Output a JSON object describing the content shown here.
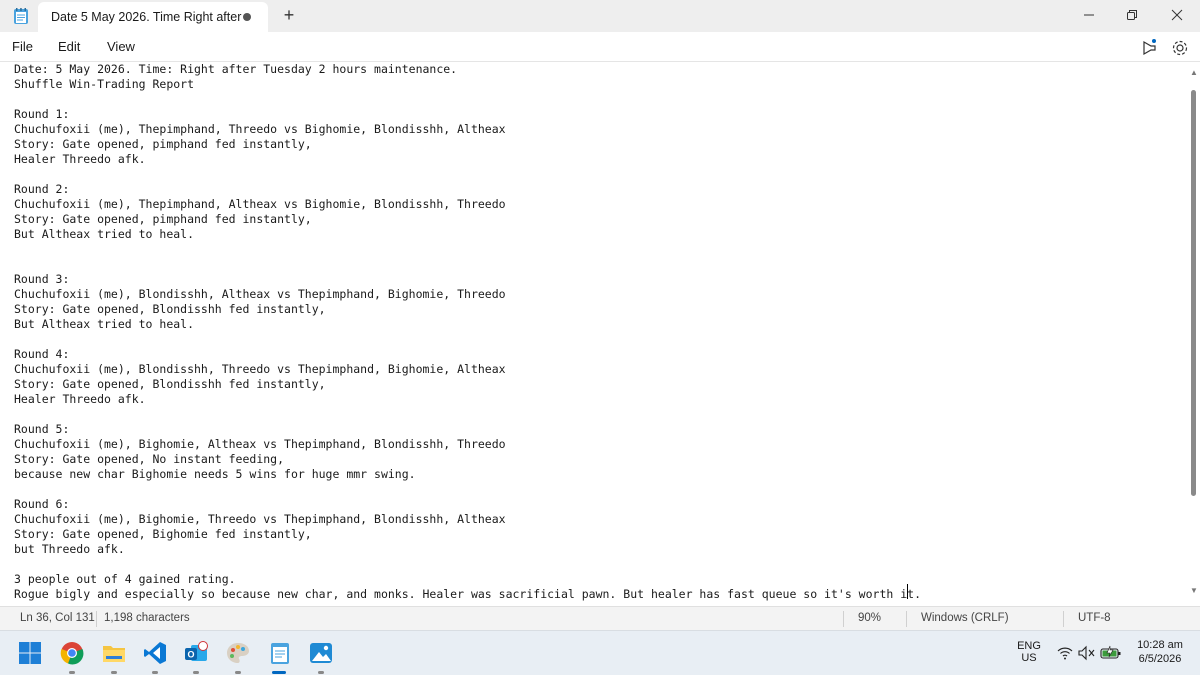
{
  "titlebar": {
    "tab_title": "Date 5 May 2026. Time Right after",
    "new_tab": "+"
  },
  "menu": {
    "file": "File",
    "edit": "Edit",
    "view": "View"
  },
  "document": {
    "lines": [
      "Date: 5 May 2026. Time: Right after Tuesday 2 hours maintenance.",
      "Shuffle Win-Trading Report",
      "",
      "Round 1:",
      "Chuchufoxii (me), Thepimphand, Threedo vs Bighomie, Blondisshh, Altheax",
      "Story: Gate opened, pimphand fed instantly,",
      "Healer Threedo afk.",
      "",
      "Round 2:",
      "Chuchufoxii (me), Thepimphand, Altheax vs Bighomie, Blondisshh, Threedo",
      "Story: Gate opened, pimphand fed instantly,",
      "But Altheax tried to heal.",
      "",
      "",
      "Round 3:",
      "Chuchufoxii (me), Blondisshh, Altheax vs Thepimphand, Bighomie, Threedo",
      "Story: Gate opened, Blondisshh fed instantly,",
      "But Altheax tried to heal.",
      "",
      "Round 4:",
      "Chuchufoxii (me), Blondisshh, Threedo vs Thepimphand, Bighomie, Altheax",
      "Story: Gate opened, Blondisshh fed instantly,",
      "Healer Threedo afk.",
      "",
      "Round 5:",
      "Chuchufoxii (me), Bighomie, Altheax vs Thepimphand, Blondisshh, Threedo",
      "Story: Gate opened, No instant feeding,",
      "because new char Bighomie needs 5 wins for huge mmr swing.",
      "",
      "Round 6:",
      "Chuchufoxii (me), Bighomie, Threedo vs Thepimphand, Blondisshh, Altheax",
      "Story: Gate opened, Bighomie fed instantly,",
      "but Threedo afk.",
      "",
      "3 people out of 4 gained rating.",
      "Rogue bigly and especially so because new char, and monks. Healer was sacrificial pawn. But healer has fast queue so it's worth it."
    ]
  },
  "status": {
    "position": "Ln 36, Col 131",
    "characters": "1,198 characters",
    "zoom": "90%",
    "line_ending": "Windows (CRLF)",
    "encoding": "UTF-8"
  },
  "tray": {
    "lang_top": "ENG",
    "lang_bottom": "US",
    "time": "10:28 am",
    "date": "6/5/2026"
  },
  "icons": [
    "notepad-icon",
    "minimize-icon",
    "maximize-icon",
    "close-icon",
    "megaphone-icon",
    "settings-icon",
    "windows-start-icon",
    "chrome-icon",
    "file-explorer-icon",
    "vscode-icon",
    "outlook-icon",
    "paint-icon",
    "notepad-taskbar-icon",
    "photos-icon",
    "wifi-icon",
    "volume-muted-icon",
    "battery-icon"
  ],
  "colors": {
    "accent": "#0067c0",
    "editor_bg": "#ffffff",
    "chrome_bg": "#eeeeee"
  }
}
